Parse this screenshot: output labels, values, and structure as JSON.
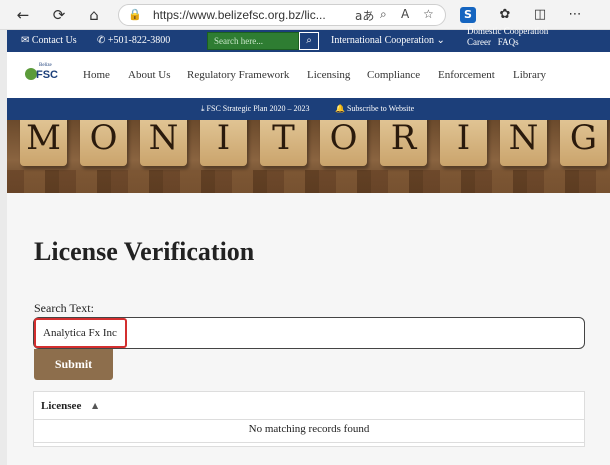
{
  "browser": {
    "url": "https://www.belizefsc.org.bz/lic...",
    "icons": [
      "back-icon",
      "refresh-icon",
      "home-icon",
      "lock-icon",
      "read-aloud-icon",
      "zoom-icon",
      "font-icon",
      "favorite-icon",
      "extension-icon",
      "extensions-icon",
      "split-icon",
      "more-icon"
    ]
  },
  "topbar": {
    "contact": "Contact Us",
    "phone": "+501-822-3800",
    "search_placeholder": "Search here...",
    "international": "International Cooperation",
    "domestic": "Domestic Cooperation",
    "career": "Career",
    "faqs": "FAQs"
  },
  "logo": {
    "small": "Belize",
    "text": "FSC"
  },
  "nav": [
    "Home",
    "About Us",
    "Regulatory Framework",
    "Licensing",
    "Compliance",
    "Enforcement",
    "Library"
  ],
  "subbar": {
    "plan": "FSC Strategic Plan 2020 – 2023",
    "subscribe": "Subscribe to Website"
  },
  "hero": {
    "letters": [
      "M",
      "O",
      "N",
      "I",
      "T",
      "O",
      "R",
      "I",
      "N",
      "G"
    ]
  },
  "main": {
    "title": "License Verification",
    "search_label": "Search Text:",
    "search_value": "Analytica Fx Inc",
    "submit": "Submit",
    "table_header": "Licensee",
    "sort_glyph": "▲",
    "empty_message": "No matching records found"
  }
}
